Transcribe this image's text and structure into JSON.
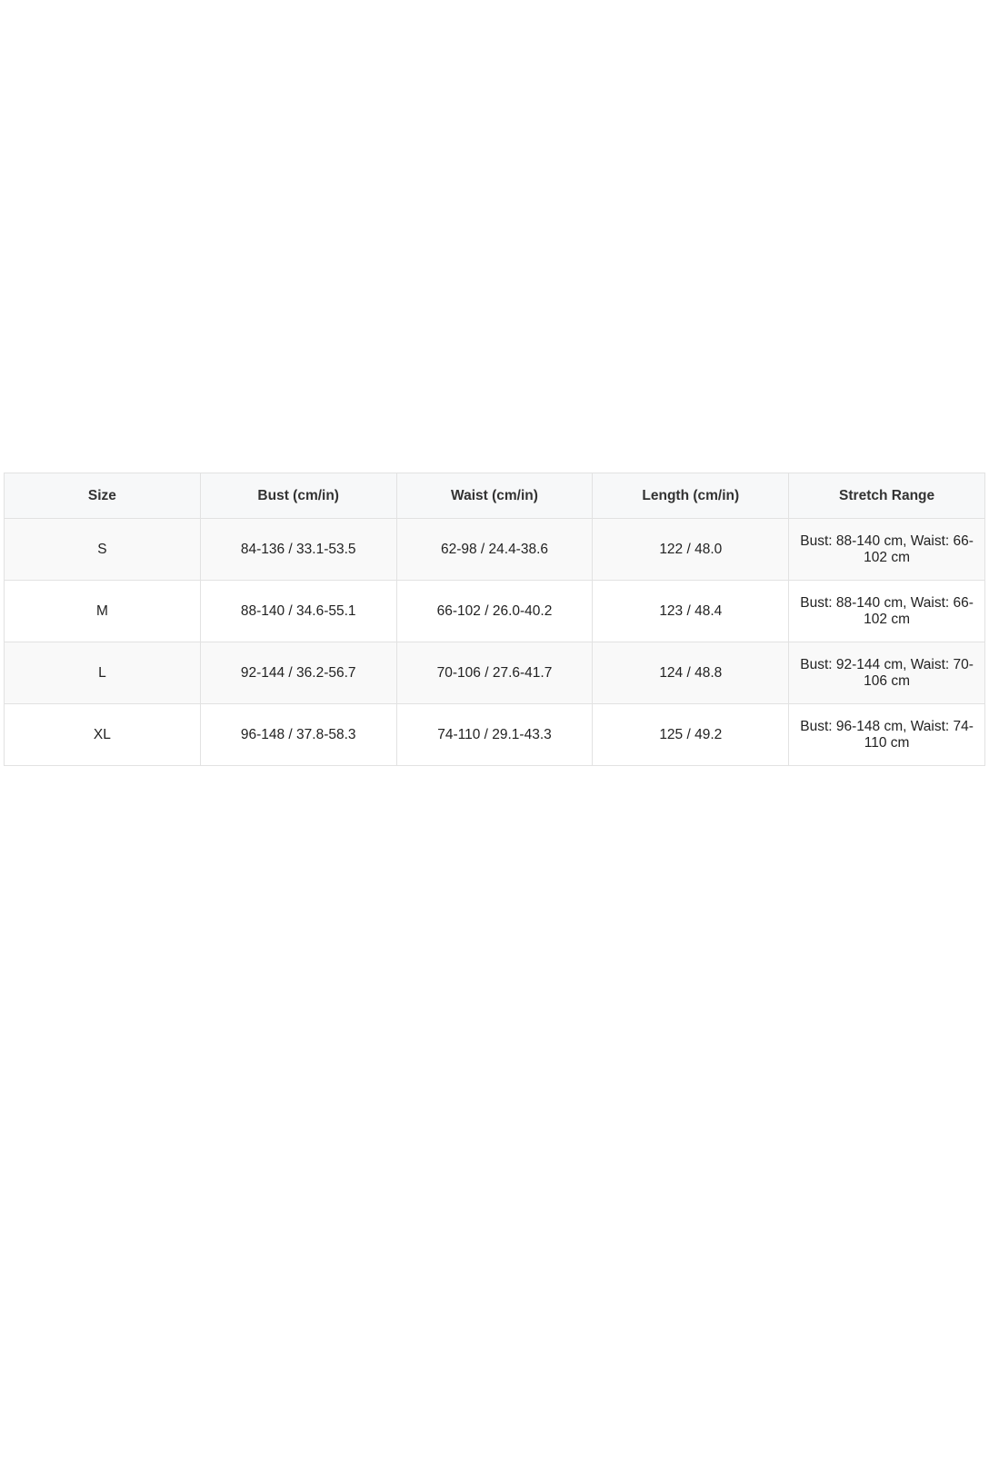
{
  "size_chart": {
    "headers": [
      "Size",
      "Bust (cm/in)",
      "Waist (cm/in)",
      "Length (cm/in)",
      "Stretch Range"
    ],
    "rows": [
      [
        "S",
        "84-136 / 33.1-53.5",
        "62-98 / 24.4-38.6",
        "122 / 48.0",
        "Bust: 88-140 cm, Waist: 66-102 cm"
      ],
      [
        "M",
        "88-140 / 34.6-55.1",
        "66-102 / 26.0-40.2",
        "123 / 48.4",
        "Bust: 88-140 cm, Waist: 66-102 cm"
      ],
      [
        "L",
        "92-144 / 36.2-56.7",
        "70-106 / 27.6-41.7",
        "124 / 48.8",
        "Bust: 92-144 cm, Waist: 70-106 cm"
      ],
      [
        "XL",
        "96-148 / 37.8-58.3",
        "74-110 / 29.1-43.3",
        "125 / 49.2",
        "Bust: 96-148 cm, Waist: 74-110 cm"
      ]
    ]
  }
}
